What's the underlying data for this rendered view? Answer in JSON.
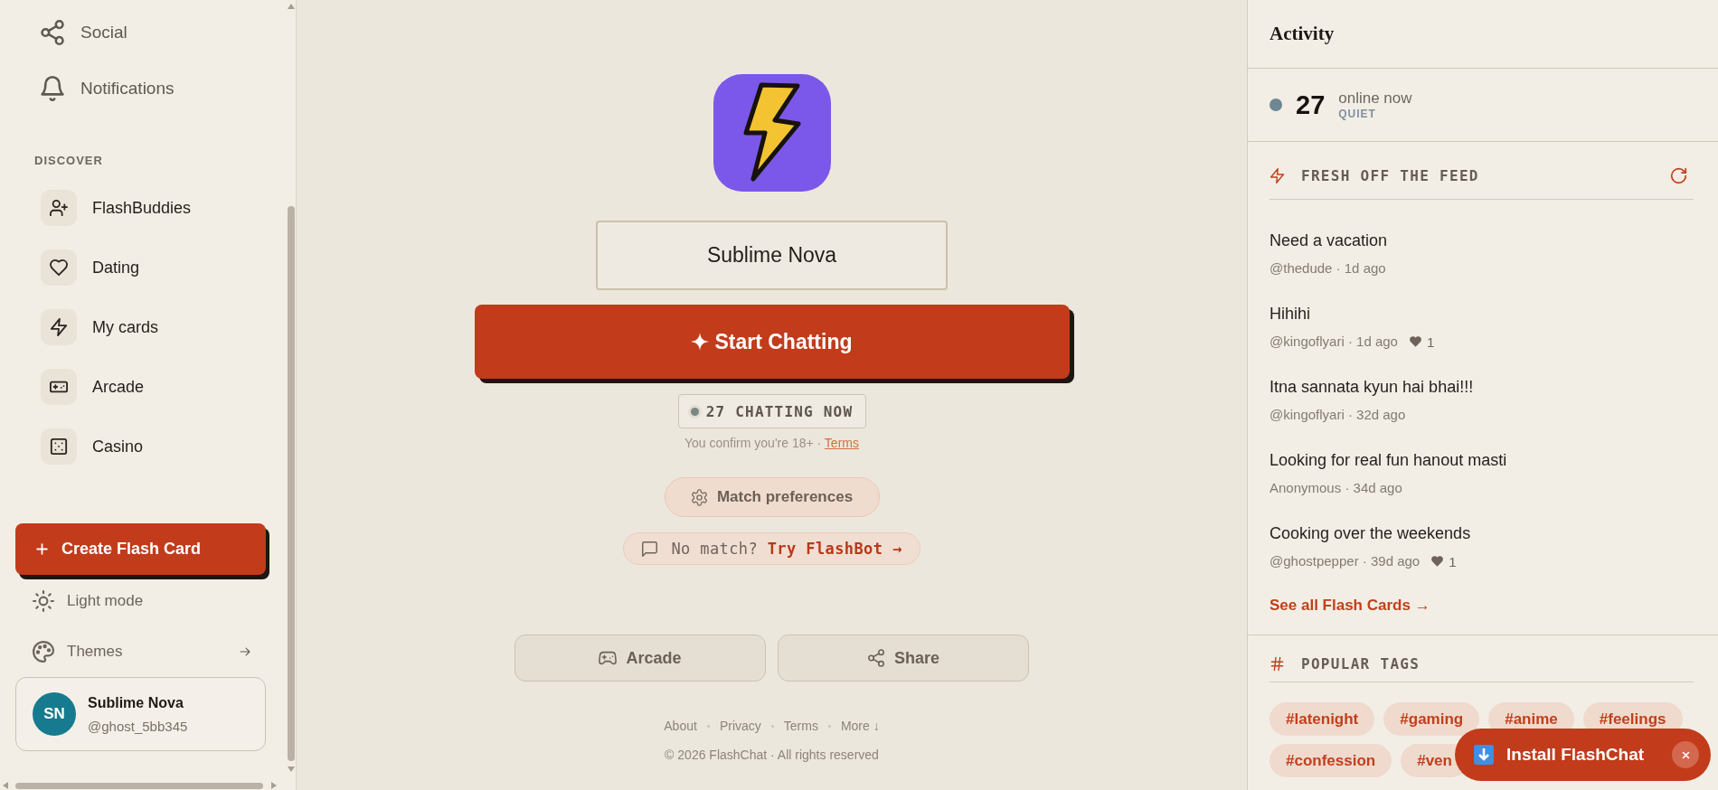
{
  "sidebar": {
    "nav_items": [
      {
        "label": "Social"
      },
      {
        "label": "Notifications"
      }
    ],
    "discover": {
      "heading": "DISCOVER",
      "items": [
        {
          "label": "FlashBuddies"
        },
        {
          "label": "Dating"
        },
        {
          "label": "My cards"
        },
        {
          "label": "Arcade"
        },
        {
          "label": "Casino"
        }
      ]
    },
    "create_button": "Create Flash Card",
    "settings_items": [
      {
        "label": "Light mode",
        "submenu": false
      },
      {
        "label": "Themes",
        "submenu": true
      }
    ],
    "user": {
      "initials": "SN",
      "name": "Sublime Nova",
      "handle": "@ghost_5bb345"
    }
  },
  "main": {
    "name_field": {
      "value": "Sublime Nova"
    },
    "start_button": "Start Chatting",
    "chatting_count": "27 CHATTING NOW",
    "age_notice": {
      "text": "You confirm you're 18+ ·",
      "link": "Terms"
    },
    "match_preferences_button": "Match preferences",
    "flashbot_prompt": "No match? **Try FlashBot →**",
    "action_buttons": [
      {
        "label": "Arcade"
      },
      {
        "label": "Share"
      }
    ],
    "footer_links": [
      "About",
      "Privacy",
      "Terms",
      "More ↓"
    ],
    "copyright": "© 2026 FlashChat · All rights reserved"
  },
  "activity_panel": {
    "title": "Activity",
    "online": {
      "count": "27",
      "label": "online now",
      "status": "QUIET"
    },
    "feed": {
      "heading": "FRESH OFF THE FEED",
      "posts": [
        {
          "title": "Need a vacation",
          "meta": "@thedude · 1d ago"
        },
        {
          "title": "Hihihi",
          "meta": "@kingoflyari · 1d ago",
          "likes": "1"
        },
        {
          "title": "Itna sannata kyun hai bhai!!!",
          "meta": "@kingoflyari · 32d ago"
        },
        {
          "title": "Looking for real fun hanout masti",
          "meta": "Anonymous · 34d ago"
        },
        {
          "title": "Cooking over the weekends",
          "meta": "@ghostpepper · 39d ago",
          "likes": "1"
        }
      ],
      "see_all_link": "See all Flash Cards →"
    },
    "popular_tags": {
      "heading": "POPULAR TAGS",
      "tags": [
        "#latenight",
        "#gaming",
        "#anime",
        "#feelings",
        "#confession",
        "#ven"
      ]
    }
  },
  "install_banner": {
    "label": "Install FlashChat"
  }
}
